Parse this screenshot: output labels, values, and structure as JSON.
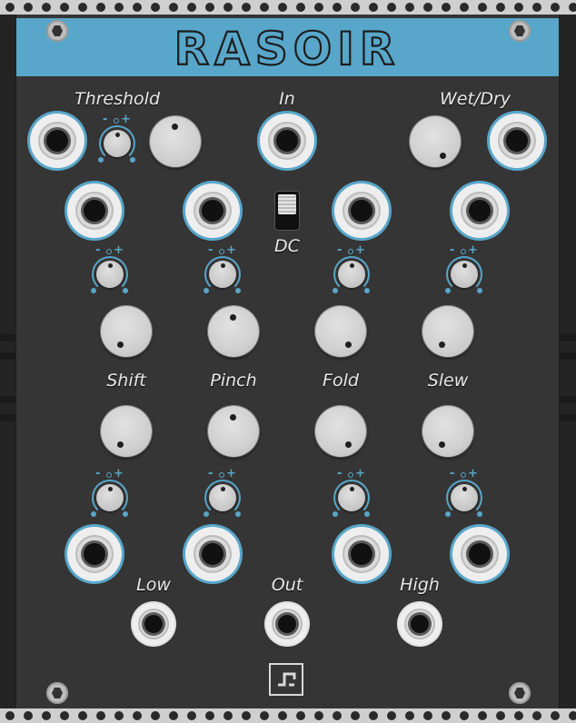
{
  "module": {
    "title": "RASOIR",
    "accent_color": "#58a6c9",
    "panel_color": "#353535"
  },
  "labels": {
    "threshold": "Threshold",
    "in": "In",
    "wet_dry": "Wet/Dry",
    "dc": "DC",
    "shift": "Shift",
    "pinch": "Pinch",
    "fold": "Fold",
    "slew": "Slew",
    "low": "Low",
    "out": "Out",
    "high": "High"
  },
  "trimmer_marks": {
    "minus": "-",
    "plus": "+"
  },
  "icons": {
    "screw": "hex-screw-icon",
    "logo": "brand-logo-icon"
  }
}
